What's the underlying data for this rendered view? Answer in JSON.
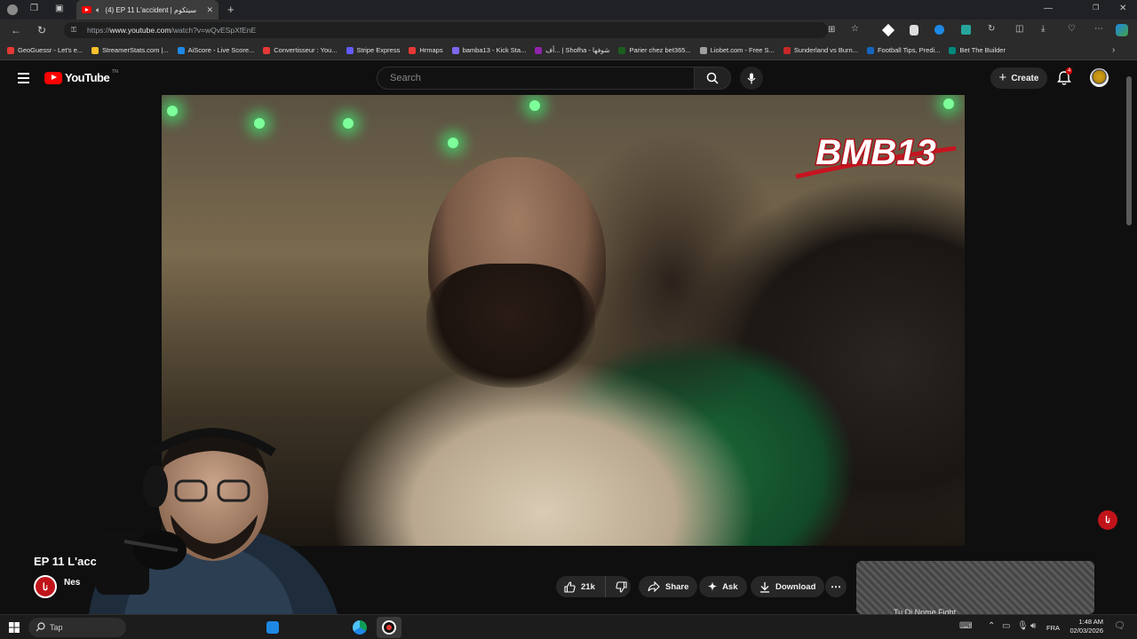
{
  "browser": {
    "tab": {
      "title": "(4) EP 11 L'accident | سيتكوم",
      "audio_icon": "speaker-icon"
    },
    "url": {
      "prefix": "https://",
      "domain": "www.youtube.com",
      "path": "/watch?v=wQvESpXfEnE"
    }
  },
  "bookmarks": [
    {
      "label": "GeoGuessr - Let's e...",
      "color": "#e53935"
    },
    {
      "label": "StreamerStats.com |...",
      "color": "#fbc02d"
    },
    {
      "label": "AiScore - Live Score...",
      "color": "#1e88e5"
    },
    {
      "label": "Convertisseur : You...",
      "color": "#e53935"
    },
    {
      "label": "Stripe Express",
      "color": "#635bff"
    },
    {
      "label": "Hrmaps",
      "color": "#e53935"
    },
    {
      "label": "bamba13 - Kick Sta...",
      "color": "#7b68ee"
    },
    {
      "label": "أف... | Shofha - شوفها",
      "color": "#8e24aa"
    },
    {
      "label": "Parier chez bet365...",
      "color": "#1b5e20"
    },
    {
      "label": "Liobet.com - Free S...",
      "color": "#9e9e9e"
    },
    {
      "label": "Sunderland vs Burn...",
      "color": "#c62828"
    },
    {
      "label": "Football Tips, Predi...",
      "color": "#1565c0"
    },
    {
      "label": "Bet The Builder",
      "color": "#00897b"
    }
  ],
  "youtube": {
    "logo_text": "YouTube",
    "logo_sup": "TN",
    "search": {
      "placeholder": "Search"
    },
    "create_label": "Create",
    "notification_count": "4"
  },
  "video": {
    "overlay_logo": "BMB13",
    "title": "EP 11 L'acc",
    "channel_name": "Nes",
    "channel_initials": "نا"
  },
  "actions": {
    "likes": "21k",
    "share": "Share",
    "ask": "Ask",
    "download": "Download"
  },
  "sidebar_next": {
    "title": "Tu Di Nome Fight..."
  },
  "taskbar": {
    "search_label": "Tap",
    "language": "FRA",
    "time": "1:48 AM",
    "date": "02/03/2026"
  }
}
